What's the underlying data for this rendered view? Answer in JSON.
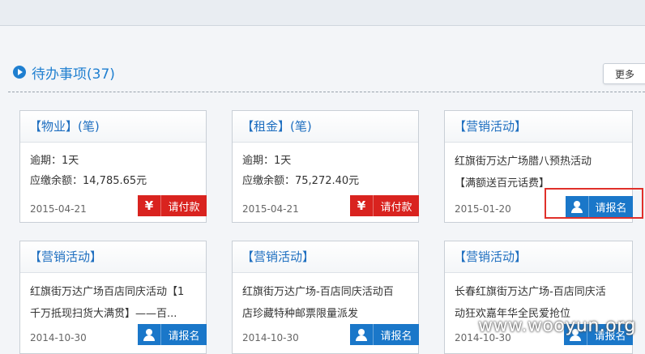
{
  "section": {
    "title": "待办事项(37)",
    "more_label": "更多"
  },
  "cards": [
    {
      "title": "【物业】(笔)",
      "lines": [
        "逾期：1天",
        "应缴余额：14,785.65元"
      ],
      "date": "2015-04-21",
      "button": "请付款",
      "button_icon": "yen-icon",
      "button_color": "#d9231f"
    },
    {
      "title": "【租金】(笔)",
      "lines": [
        "逾期：1天",
        "应缴余额：75,272.40元"
      ],
      "date": "2015-04-21",
      "button": "请付款",
      "button_icon": "yen-icon",
      "button_color": "#d9231f"
    },
    {
      "title": "【营销活动】",
      "lines": [
        "红旗街万达广场腊八预热活动",
        "【满额送百元话费】"
      ],
      "date": "2015-01-20",
      "button": "请报名",
      "button_icon": "person-icon",
      "button_color": "#1a77c9"
    },
    {
      "title": "【营销活动】",
      "lines": [
        "红旗街万达广场百店同庆活动【1",
        "千万抵现扫货大满贯】——百..."
      ],
      "date": "2014-10-30",
      "button": "请报名",
      "button_icon": "person-icon",
      "button_color": "#1a77c9"
    },
    {
      "title": "【营销活动】",
      "lines": [
        "红旗街万达广场-百店同庆活动百",
        "店珍藏特种邮票限量派发"
      ],
      "date": "2014-10-30",
      "button": "请报名",
      "button_icon": "person-icon",
      "button_color": "#1a77c9"
    },
    {
      "title": "【营销活动】",
      "lines": [
        "长春红旗街万达广场-百店同庆活",
        "动狂欢嘉年华全民爱抢位"
      ],
      "date": "2014-10-30",
      "button": "请报名",
      "button_icon": "person-icon",
      "button_color": "#1a77c9"
    }
  ],
  "yen_glyph": "¥",
  "watermark": "www.wooyun.org"
}
